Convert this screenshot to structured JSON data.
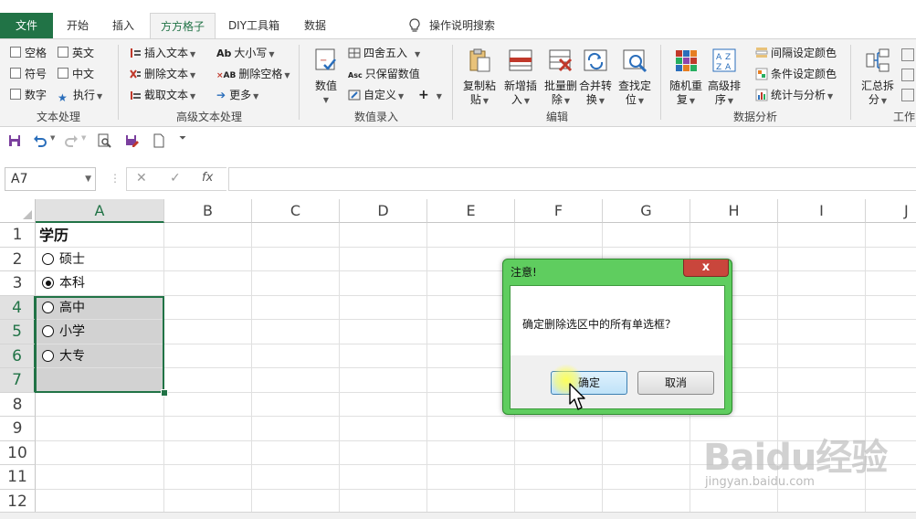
{
  "tabs": {
    "file": "文件",
    "home": "开始",
    "insert": "插入",
    "ffgz": "方方格子",
    "diy": "DIY工具箱",
    "data": "数据",
    "search": "操作说明搜索"
  },
  "ribbon": {
    "text_group": {
      "label": "文本处理",
      "space": "空格",
      "english": "英文",
      "symbol": "符号",
      "chinese": "中文",
      "number": "数字",
      "execute": "执行"
    },
    "adv_text_group": {
      "label": "高级文本处理",
      "insert_text": "插入文本",
      "delete_text": "删除文本",
      "extract_text": "截取文本",
      "case": "大小写",
      "delete_space": "删除空格",
      "more": "更多",
      "case_icon": "Ab",
      "delete_space_icon": "AB"
    },
    "numeric_group": {
      "label": "数值录入",
      "number": "数值",
      "round": "四舍五入",
      "keep_value": "只保留数值",
      "custom": "自定义",
      "keep_value_icon": "Asc",
      "plus": "+"
    },
    "edit_group": {
      "label": "编辑",
      "copy_paste": [
        "复制粘",
        "贴"
      ],
      "new_insert": [
        "新增插",
        "入"
      ],
      "batch_delete": [
        "批量删",
        "除"
      ],
      "merge": [
        "合并转",
        "换"
      ],
      "find_locate": [
        "查找定",
        "位"
      ]
    },
    "analysis_group": {
      "label": "数据分析",
      "random": [
        "随机重",
        "复"
      ],
      "advanced_sort": [
        "高级排",
        "序"
      ],
      "interval_color": "间隔设定颜色",
      "cond_color": "条件设定颜色",
      "stats": "统计与分析"
    },
    "summary_group": {
      "label": "工作",
      "summary_split": [
        "汇总拆",
        "分"
      ]
    }
  },
  "namebox": {
    "value": "A7"
  },
  "formula_symbols": {
    "cancel": "✕",
    "enter": "✓",
    "fx": "fx"
  },
  "grid": {
    "columns": [
      "A",
      "B",
      "C",
      "D",
      "E",
      "F",
      "G",
      "H",
      "I",
      "J"
    ],
    "rows": [
      "1",
      "2",
      "3",
      "4",
      "5",
      "6",
      "7",
      "8",
      "9",
      "10",
      "11",
      "12"
    ],
    "a1": "学历",
    "options": [
      {
        "label": "硕士",
        "checked": false
      },
      {
        "label": "本科",
        "checked": true
      },
      {
        "label": "高中",
        "checked": false
      },
      {
        "label": "小学",
        "checked": false
      },
      {
        "label": "大专",
        "checked": false
      }
    ]
  },
  "dialog": {
    "title": "注意!",
    "close": "x",
    "message": "确定删除选区中的所有单选框？",
    "ok": "确定",
    "cancel": "取消"
  },
  "watermark": {
    "brand": "Baidu经验",
    "url": "jingyan.baidu.com"
  },
  "colors": {
    "accent": "#217346",
    "dialog_frame": "#5fcd5f",
    "close_button": "#c9463c",
    "selection": "#d2d2d2"
  }
}
